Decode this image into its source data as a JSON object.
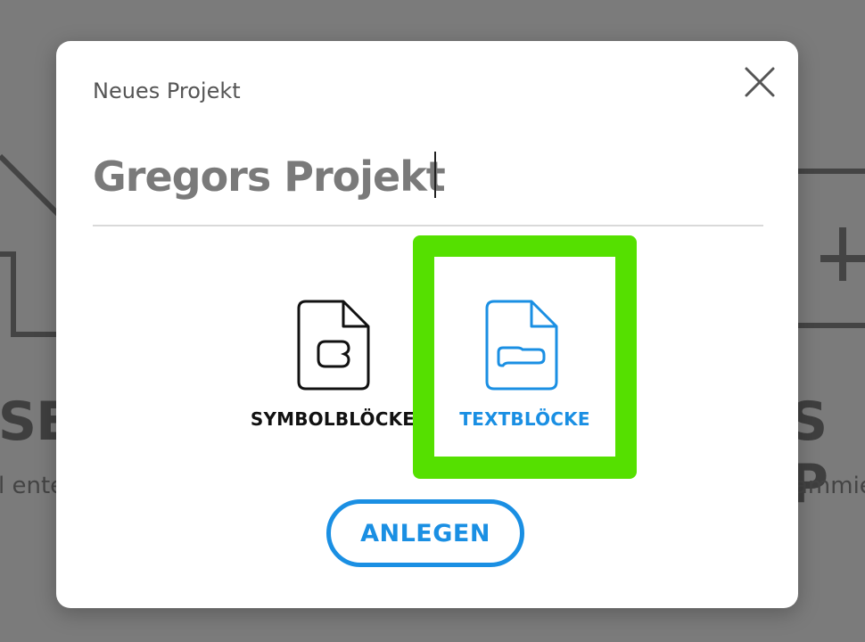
{
  "background": {
    "left_heading": "TSE",
    "left_subtext": "l ente",
    "right_heading": "S P",
    "right_subtext": "ammie"
  },
  "dialog": {
    "caption": "Neues Projekt",
    "project_name": "Gregors Projekt",
    "options": [
      {
        "label": "SYMBOLBLÖCKE",
        "icon": "symbol-document-icon",
        "selected": false
      },
      {
        "label": "TEXTBLÖCKE",
        "icon": "text-document-icon",
        "selected": true
      }
    ],
    "create_label": "ANLEGEN"
  },
  "colors": {
    "accent": "#1a8fe3",
    "selection_highlight": "#55e000",
    "overlay": "#7b7b7b"
  }
}
